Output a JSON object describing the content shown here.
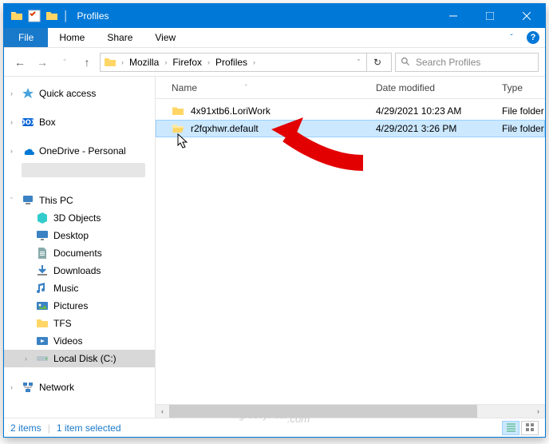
{
  "titlebar": {
    "title": "Profiles"
  },
  "ribbon": {
    "file": "File",
    "home": "Home",
    "share": "Share",
    "view": "View"
  },
  "breadcrumb": [
    "Mozilla",
    "Firefox",
    "Profiles"
  ],
  "search": {
    "placeholder": "Search Profiles"
  },
  "columns": {
    "name": "Name",
    "date": "Date modified",
    "type": "Type"
  },
  "rows": [
    {
      "name": "4x91xtb6.LoriWork",
      "date": "4/29/2021 10:23 AM",
      "type": "File folder",
      "selected": false
    },
    {
      "name": "r2fqxhwr.default",
      "date": "4/29/2021 3:26 PM",
      "type": "File folder",
      "selected": true
    }
  ],
  "sidebar": {
    "quick": "Quick access",
    "box": "Box",
    "onedrive": "OneDrive - Personal",
    "thispc": "This PC",
    "pc": [
      "3D Objects",
      "Desktop",
      "Documents",
      "Downloads",
      "Music",
      "Pictures",
      "TFS",
      "Videos",
      "Local Disk (C:)"
    ],
    "network": "Network"
  },
  "statusbar": {
    "count": "2 items",
    "selected": "1 item selected"
  },
  "watermark": "groovyPost"
}
